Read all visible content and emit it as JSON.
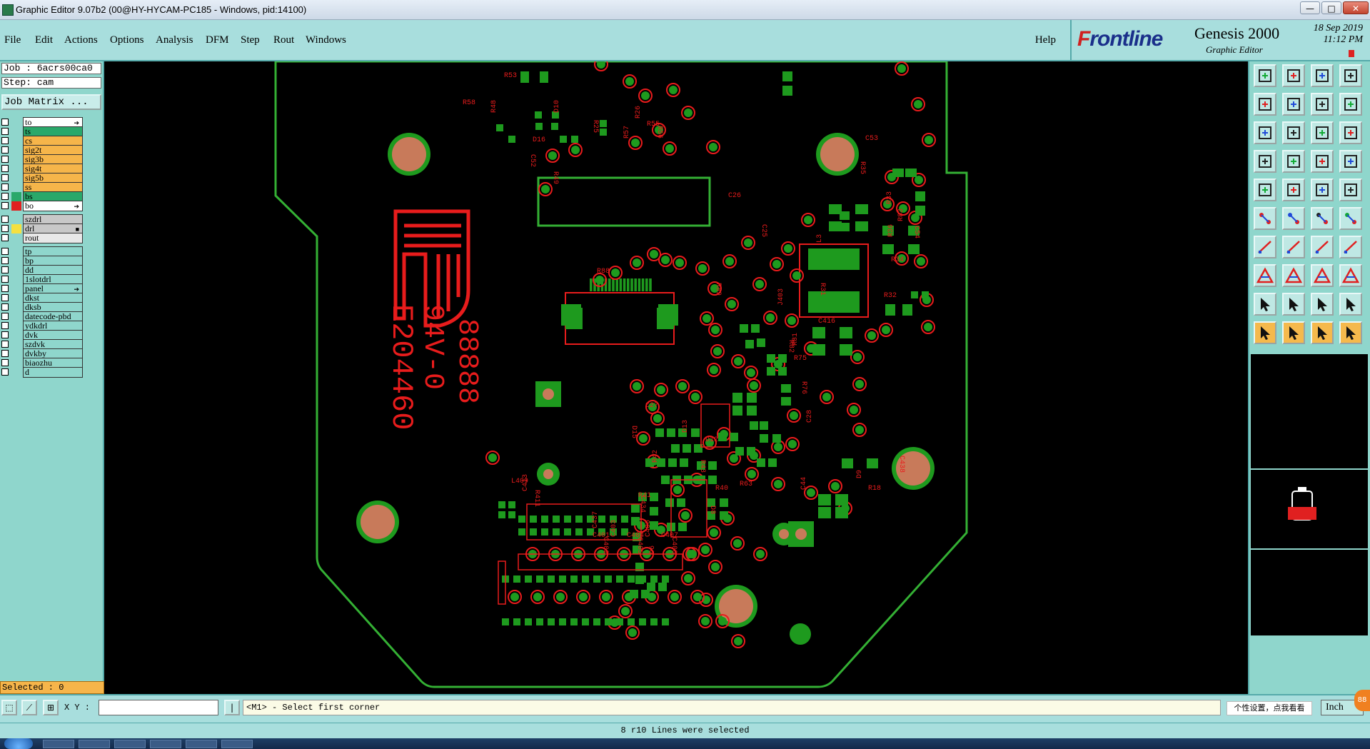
{
  "titlebar": {
    "title": "Graphic Editor 9.07b2 (00@HY-HYCAM-PC185 - Windows, pid:14100)",
    "min": "—",
    "max": "□",
    "close": "✕"
  },
  "menubar": {
    "items": [
      "File",
      "Edit",
      "Actions",
      "Options",
      "Analysis",
      "DFM",
      "Step",
      "Rout",
      "Windows"
    ],
    "help": "Help"
  },
  "brand": {
    "logo_f": "F",
    "logo_rest": "rontline",
    "product": "Genesis 2000",
    "subtitle": "Graphic Editor",
    "date": "18 Sep 2019",
    "time": "11:12 PM"
  },
  "left": {
    "job": "Job : 6acrs00ca0",
    "step": "Step: cam",
    "job_matrix": "Job Matrix ...",
    "layers": [
      {
        "name": "to",
        "bg": "#ffffff",
        "swatch": "",
        "mark": "➔"
      },
      {
        "name": "ts",
        "bg": "#2aa86a",
        "swatch": "",
        "mark": ""
      },
      {
        "name": "cs",
        "bg": "#f6b54a",
        "swatch": "",
        "mark": ""
      },
      {
        "name": "sig2t",
        "bg": "#f6b54a",
        "swatch": "",
        "mark": ""
      },
      {
        "name": "sig3b",
        "bg": "#f6b54a",
        "swatch": "",
        "mark": ""
      },
      {
        "name": "sig4t",
        "bg": "#f6b54a",
        "swatch": "",
        "mark": ""
      },
      {
        "name": "sig5b",
        "bg": "#f6b54a",
        "swatch": "",
        "mark": ""
      },
      {
        "name": "ss",
        "bg": "#f6b54a",
        "swatch": "",
        "mark": ""
      },
      {
        "name": "bs",
        "bg": "#2aa86a",
        "swatch": "#2aa86a",
        "mark": ""
      },
      {
        "name": "bo",
        "bg": "#ffffff",
        "swatch": "#e02020",
        "mark": "➔"
      },
      {
        "name": "szdrl",
        "bg": "#c8c8c8",
        "swatch": "",
        "mark": ""
      },
      {
        "name": "drl",
        "bg": "#c8c8c8",
        "swatch": "#f5e040",
        "mark": "■"
      },
      {
        "name": "rout",
        "bg": "#e8e8e8",
        "swatch": "",
        "mark": ""
      },
      {
        "name": "tp",
        "bg": "#8fd6cc",
        "swatch": "",
        "mark": ""
      },
      {
        "name": "bp",
        "bg": "#8fd6cc",
        "swatch": "",
        "mark": ""
      },
      {
        "name": "dd",
        "bg": "#8fd6cc",
        "swatch": "",
        "mark": ""
      },
      {
        "name": "1slotdrl",
        "bg": "#8fd6cc",
        "swatch": "",
        "mark": ""
      },
      {
        "name": "panel",
        "bg": "#8fd6cc",
        "swatch": "",
        "mark": "➔"
      },
      {
        "name": "dkst",
        "bg": "#8fd6cc",
        "swatch": "",
        "mark": ""
      },
      {
        "name": "dksb",
        "bg": "#8fd6cc",
        "swatch": "",
        "mark": ""
      },
      {
        "name": "datecode-pbd",
        "bg": "#8fd6cc",
        "swatch": "",
        "mark": ""
      },
      {
        "name": "ydkdrl",
        "bg": "#8fd6cc",
        "swatch": "",
        "mark": ""
      },
      {
        "name": "dvk",
        "bg": "#8fd6cc",
        "swatch": "",
        "mark": ""
      },
      {
        "name": "szdvk",
        "bg": "#8fd6cc",
        "swatch": "",
        "mark": ""
      },
      {
        "name": "dvkby",
        "bg": "#8fd6cc",
        "swatch": "",
        "mark": ""
      },
      {
        "name": "biaozhu",
        "bg": "#8fd6cc",
        "swatch": "",
        "mark": ""
      },
      {
        "name": "d",
        "bg": "#8fd6cc",
        "swatch": "",
        "mark": ""
      }
    ],
    "selected": "Selected : 0"
  },
  "canvas": {
    "silk_labels": [
      "R53",
      "R49",
      "R48",
      "R58",
      "C52",
      "D10",
      "D16",
      "R25",
      "R26",
      "R55",
      "R56",
      "R57",
      "C26",
      "C25",
      "L3",
      "R32",
      "R31",
      "R33",
      "R34",
      "R35",
      "R36",
      "C53",
      "C54",
      "R83",
      "R88",
      "R89",
      "J403",
      "C416",
      "R82",
      "R81",
      "R75",
      "R76",
      "C28",
      "C27",
      "D15",
      "D13",
      "D12",
      "R43",
      "R42",
      "R40",
      "D8",
      "D9",
      "R18",
      "C438",
      "C44",
      "R63",
      "C434",
      "C437",
      "C401",
      "C402",
      "C403",
      "C404",
      "C405",
      "C406",
      "C407",
      "C408",
      "D6",
      "R41",
      "R411",
      "C413",
      "L409"
    ],
    "marking_1": "E204460",
    "marking_2": "94V-0",
    "marking_3": "88888"
  },
  "bottom": {
    "xy_label": "X Y :",
    "xy_value": "",
    "prompt": "<M1> - Select first corner",
    "ime_hint": "个性设置，点我看看",
    "units": "Inch",
    "status": "8 r10 Lines were selected",
    "tray_badge": "88"
  },
  "colors": {
    "pad": "#1e9a1e",
    "outline": "#34b034",
    "silk": "#e81c1c",
    "hole": "#c87a5a",
    "panel": "#8fd6cc",
    "menu": "#a8dedd"
  }
}
